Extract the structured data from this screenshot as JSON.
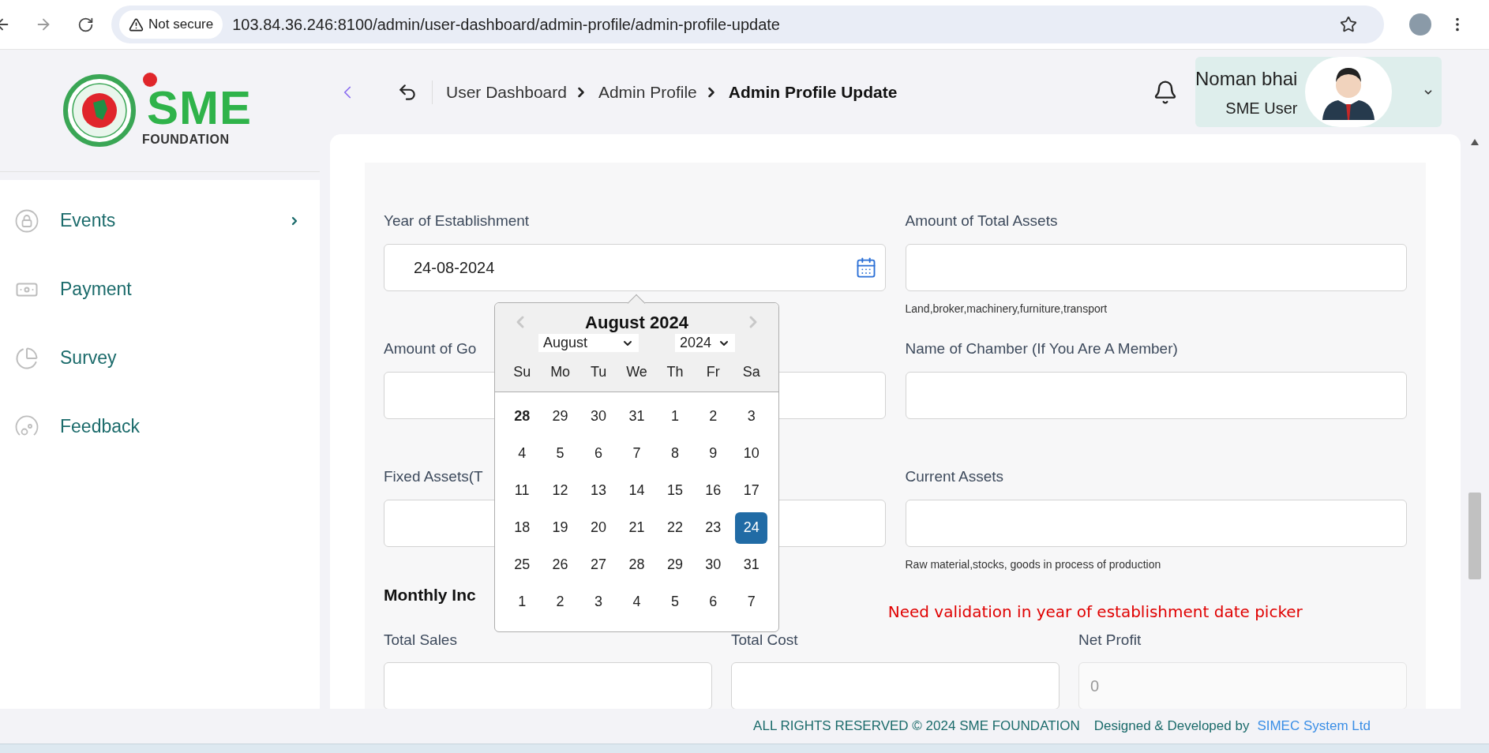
{
  "browser": {
    "security": "Not secure",
    "url": "103.84.36.246:8100/admin/user-dashboard/admin-profile/admin-profile-update"
  },
  "logo": {
    "name": "SME",
    "subtitle": "FOUNDATION"
  },
  "sidebar": {
    "items": [
      {
        "label": "Events",
        "expandable": true
      },
      {
        "label": "Payment",
        "expandable": false
      },
      {
        "label": "Survey",
        "expandable": false
      },
      {
        "label": "Feedback",
        "expandable": false
      }
    ]
  },
  "breadcrumb": [
    {
      "label": "User Dashboard",
      "current": false
    },
    {
      "label": "Admin Profile",
      "current": false
    },
    {
      "label": "Admin Profile Update",
      "current": true
    }
  ],
  "user": {
    "name": "Noman bhai",
    "role": "SME User"
  },
  "form": {
    "fields": [
      {
        "kind": "date",
        "label": "Year of Establishment",
        "value": "24-08-2024"
      },
      {
        "kind": "text",
        "label": "Amount of Total Assets",
        "helper": "Land,broker,machinery,furniture,transport"
      },
      {
        "kind": "text",
        "label": "Amount of Go"
      },
      {
        "kind": "text",
        "label": "Name of Chamber (If You Are A Member)"
      },
      {
        "kind": "text",
        "label": "Fixed Assets(T"
      },
      {
        "kind": "text",
        "label": "Current Assets",
        "helper": "Raw material,stocks, goods in process of production"
      }
    ],
    "section_title": "Monthly Inc",
    "note": "Need validation in year of establishment date picker",
    "income_fields": [
      {
        "label": "Total Sales",
        "disabled": false
      },
      {
        "label": "Total Cost",
        "disabled": false
      },
      {
        "label": "Net Profit",
        "value": "0",
        "disabled": true
      }
    ]
  },
  "datepicker": {
    "title": "August 2024",
    "month": "August",
    "year": "2024",
    "weekdays": [
      "Su",
      "Mo",
      "Tu",
      "We",
      "Th",
      "Fr",
      "Sa"
    ],
    "weeks": [
      [
        {
          "label": "28",
          "selected": false,
          "highlighted": true
        },
        {
          "label": "29",
          "selected": false,
          "highlighted": false
        },
        {
          "label": "30",
          "selected": false,
          "highlighted": false
        },
        {
          "label": "31",
          "selected": false,
          "highlighted": false
        },
        {
          "label": "1",
          "selected": false,
          "highlighted": false
        },
        {
          "label": "2",
          "selected": false,
          "highlighted": false
        },
        {
          "label": "3",
          "selected": false,
          "highlighted": false
        }
      ],
      [
        {
          "label": "4",
          "selected": false,
          "highlighted": false
        },
        {
          "label": "5",
          "selected": false,
          "highlighted": false
        },
        {
          "label": "6",
          "selected": false,
          "highlighted": false
        },
        {
          "label": "7",
          "selected": false,
          "highlighted": false
        },
        {
          "label": "8",
          "selected": false,
          "highlighted": false
        },
        {
          "label": "9",
          "selected": false,
          "highlighted": false
        },
        {
          "label": "10",
          "selected": false,
          "highlighted": false
        }
      ],
      [
        {
          "label": "11",
          "selected": false,
          "highlighted": false
        },
        {
          "label": "12",
          "selected": false,
          "highlighted": false
        },
        {
          "label": "13",
          "selected": false,
          "highlighted": false
        },
        {
          "label": "14",
          "selected": false,
          "highlighted": false
        },
        {
          "label": "15",
          "selected": false,
          "highlighted": false
        },
        {
          "label": "16",
          "selected": false,
          "highlighted": false
        },
        {
          "label": "17",
          "selected": false,
          "highlighted": false
        }
      ],
      [
        {
          "label": "18",
          "selected": false,
          "highlighted": false
        },
        {
          "label": "19",
          "selected": false,
          "highlighted": false
        },
        {
          "label": "20",
          "selected": false,
          "highlighted": false
        },
        {
          "label": "21",
          "selected": false,
          "highlighted": false
        },
        {
          "label": "22",
          "selected": false,
          "highlighted": false
        },
        {
          "label": "23",
          "selected": false,
          "highlighted": false
        },
        {
          "label": "24",
          "selected": true,
          "highlighted": false
        }
      ],
      [
        {
          "label": "25",
          "selected": false,
          "highlighted": false
        },
        {
          "label": "26",
          "selected": false,
          "highlighted": false
        },
        {
          "label": "27",
          "selected": false,
          "highlighted": false
        },
        {
          "label": "28",
          "selected": false,
          "highlighted": false
        },
        {
          "label": "29",
          "selected": false,
          "highlighted": false
        },
        {
          "label": "30",
          "selected": false,
          "highlighted": false
        },
        {
          "label": "31",
          "selected": false,
          "highlighted": false
        }
      ],
      [
        {
          "label": "1",
          "selected": false,
          "highlighted": false
        },
        {
          "label": "2",
          "selected": false,
          "highlighted": false
        },
        {
          "label": "3",
          "selected": false,
          "highlighted": false
        },
        {
          "label": "4",
          "selected": false,
          "highlighted": false
        },
        {
          "label": "5",
          "selected": false,
          "highlighted": false
        },
        {
          "label": "6",
          "selected": false,
          "highlighted": false
        },
        {
          "label": "7",
          "selected": false,
          "highlighted": false
        }
      ]
    ]
  },
  "footer": {
    "rights": "ALL RIGHTS RESERVED © 2024 SME FOUNDATION",
    "credit": "Designed & Developed by",
    "link": "SIMEC System Ltd"
  }
}
